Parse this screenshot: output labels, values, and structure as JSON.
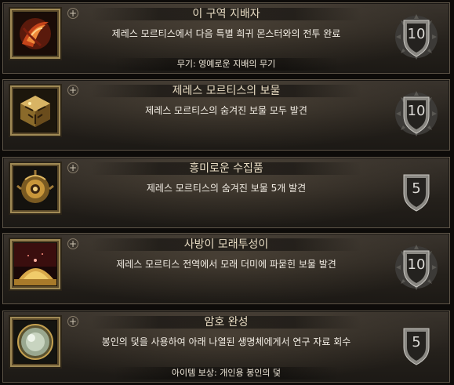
{
  "achievements": [
    {
      "title": "이 구역 지배자",
      "description": "제레스 모르티스에서 다음 특별 희귀 몬스터와의 전투 완료",
      "reward": "무기: 영예로운 지배의 무기",
      "points": "10",
      "icon": "blade-swirl-icon"
    },
    {
      "title": "제레스 모르티스의 보물",
      "description": "제레스 모르티스의 숨겨진 보물 모두 발견",
      "reward": "",
      "points": "10",
      "icon": "golden-cube-icon"
    },
    {
      "title": "흥미로운 수집품",
      "description": "제레스 모르티스의 숨겨진 보물 5개 발견",
      "reward": "",
      "points": "5",
      "icon": "golden-orb-device-icon"
    },
    {
      "title": "사방이 모래투성이",
      "description": "제레스 모르티스 전역에서 모래 더미에 파묻힌 보물 발견",
      "reward": "",
      "points": "10",
      "icon": "sand-pile-icon"
    },
    {
      "title": "암호 완성",
      "description": "봉인의 덫을 사용하여 아래 나열된 생명체에게서 연구 자료 회수",
      "reward": "아이템 보상: 개인용 봉인의 덫",
      "points": "5",
      "icon": "sealing-trap-orb-icon"
    }
  ],
  "colors": {
    "frame_gold": "#a08a55",
    "row_border": "#5e5548",
    "title_text": "#e8dcc3",
    "badge_gray": "#7b7974"
  }
}
